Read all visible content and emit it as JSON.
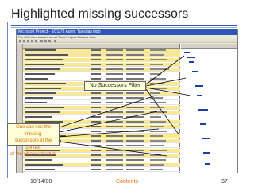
{
  "slide": {
    "title": "Highlighted missing successors",
    "footer": {
      "date": "10/14/08",
      "link": "Contents",
      "page": "37"
    }
  },
  "window": {
    "title": "Microsoft Project - 9/21/78 Agent Tuesday.mpp",
    "menu": "File  Edit  View  Insert  Format  Tools  Project  Window  Help"
  },
  "callouts": {
    "filter": "No Successors Filter",
    "note_line1": "One can see the missing",
    "note_line2": "successors in the context",
    "note_line3": "of the whole schedule"
  },
  "colors": {
    "accent": "#3a5db8",
    "highlight": "#fde98a",
    "arrow": "#000000",
    "link": "#e36c09"
  }
}
